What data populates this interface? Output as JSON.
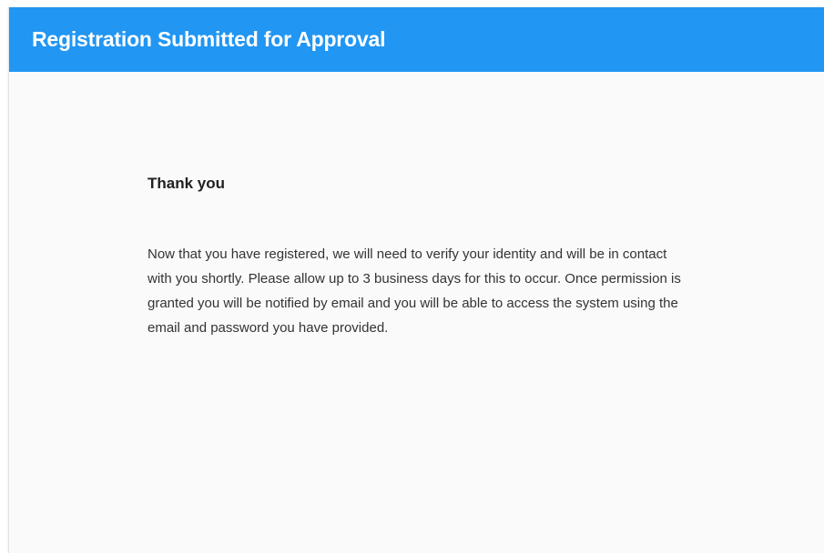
{
  "header": {
    "title": "Registration Submitted for Approval"
  },
  "main": {
    "heading": "Thank you",
    "message": "Now that you have registered, we will need to verify your identity and will be in contact with you shortly. Please allow up to 3 business days for this to occur. Once permission is granted you will be notified by email and you will be able to access the system using the email and password you have provided."
  },
  "colors": {
    "header_background": "#2196f3",
    "header_text": "#ffffff",
    "card_background": "#fafafa"
  }
}
